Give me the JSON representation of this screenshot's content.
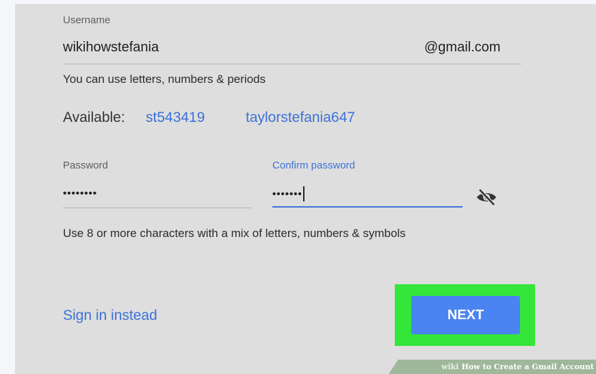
{
  "form": {
    "username": {
      "label": "Username",
      "value": "wikihowstefania",
      "suffix": "@gmail.com",
      "hint": "You can use letters, numbers & periods"
    },
    "available": {
      "label": "Available:",
      "suggestions": [
        "st543419",
        "taylorstefania647"
      ]
    },
    "password": {
      "label": "Password",
      "value_masked": "••••••••"
    },
    "confirm_password": {
      "label": "Confirm password",
      "value_masked": "•••••••"
    },
    "visibility_toggle_icon": "eye-off-icon",
    "password_hint": "Use 8 or more characters with a mix of letters, numbers & symbols"
  },
  "actions": {
    "sign_in_link": "Sign in instead",
    "next_button": "NEXT"
  },
  "watermark": {
    "brand": "wiki",
    "title": "How to Create a Gmail Account"
  },
  "colors": {
    "accent_blue": "#3c72d8",
    "button_blue": "#4a84f0",
    "highlight_green": "#34e53a",
    "card_bg": "#dedede"
  }
}
